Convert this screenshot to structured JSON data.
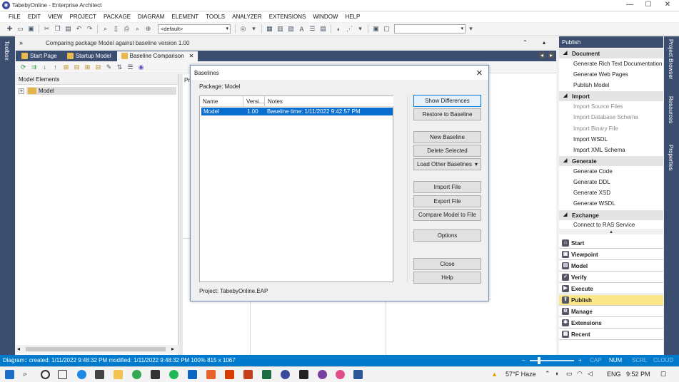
{
  "window": {
    "title": "TabebyOnline - Enterprise Architect",
    "minimize": "—",
    "maximize": "☐",
    "close": "✕"
  },
  "menu": [
    "FILE",
    "EDIT",
    "VIEW",
    "PROJECT",
    "PACKAGE",
    "DIAGRAM",
    "ELEMENT",
    "TOOLS",
    "ANALYZER",
    "EXTENSIONS",
    "WINDOW",
    "HELP"
  ],
  "toolbar": {
    "workspace_combo": "<default>",
    "search_combo": ""
  },
  "toolbox_label": "Toolbox",
  "infobar": {
    "chevron": "»",
    "text": "Comparing package Model against baseline version 1.00"
  },
  "tabs": [
    {
      "label": "Start Page"
    },
    {
      "label": "Startup Model"
    },
    {
      "label": "Baseline Comparison",
      "close": "✕"
    }
  ],
  "left_pane": {
    "header": "Model Elements",
    "tree_item": "Model",
    "expand": "+",
    "peek": "Pr"
  },
  "dialog": {
    "title": "Baselines",
    "close": "✕",
    "package_label": "Package: Model",
    "columns": [
      "Name",
      "Versi...",
      "Notes"
    ],
    "rows": [
      {
        "name": "Model",
        "version": "1.00",
        "notes": "Baseline time: 1/11/2022 9:42:57 PM"
      }
    ],
    "project_label": "Project: TabebyOnline.EAP",
    "buttons": {
      "show_diff": "Show Differences",
      "restore": "Restore to Baseline",
      "new": "New Baseline",
      "delete": "Delete Selected",
      "load": "Load Other Baselines",
      "import": "Import File",
      "export": "Export File",
      "compare": "Compare Model to File",
      "options": "Options",
      "close": "Close",
      "help": "Help"
    }
  },
  "publish": {
    "header": "Publish",
    "sections": [
      {
        "title": "Document",
        "items": [
          {
            "label": "Generate Rich Text Documentation",
            "disabled": false
          },
          {
            "label": "Generate Web Pages",
            "disabled": false
          },
          {
            "label": "Publish Model",
            "disabled": false
          }
        ]
      },
      {
        "title": "Import",
        "items": [
          {
            "label": "Import Source Files",
            "disabled": true
          },
          {
            "label": "Import Database Schema",
            "disabled": true
          },
          {
            "label": "Import Binary File",
            "disabled": true
          },
          {
            "label": "Import WSDL",
            "disabled": false
          },
          {
            "label": "Import XML Schema",
            "disabled": false
          }
        ]
      },
      {
        "title": "Generate",
        "items": [
          {
            "label": "Generate Code",
            "disabled": false
          },
          {
            "label": "Generate DDL",
            "disabled": false
          },
          {
            "label": "Generate XSD",
            "disabled": false
          },
          {
            "label": "Generate WSDL",
            "disabled": false
          }
        ]
      },
      {
        "title": "Exchange",
        "items": [
          {
            "label": "Connect to RAS Service",
            "disabled": false
          }
        ]
      }
    ],
    "nav": [
      "Start",
      "Viewpoint",
      "Model",
      "Verify",
      "Execute",
      "Publish",
      "Manage",
      "Extensions",
      "Recent"
    ],
    "nav_selected": "Publish"
  },
  "right_tabs": [
    "Project Browser",
    "Resources",
    "Properties"
  ],
  "status": {
    "text": "Diagram::  created: 1/11/2022 9:48:32 PM  modified: 1/11/2022 9:48:32 PM  100%  815 x 1067",
    "flags": [
      "CAP",
      "NUM",
      "SCRL",
      "CLOUD"
    ]
  },
  "taskbar": {
    "weather": "57°F  Haze",
    "lang": "ENG",
    "time": "9:52 PM"
  },
  "colors": {
    "accent": "#3b4e70",
    "status": "#007acc",
    "selection": "#0a6ed1",
    "highlight": "#fbe68a"
  }
}
